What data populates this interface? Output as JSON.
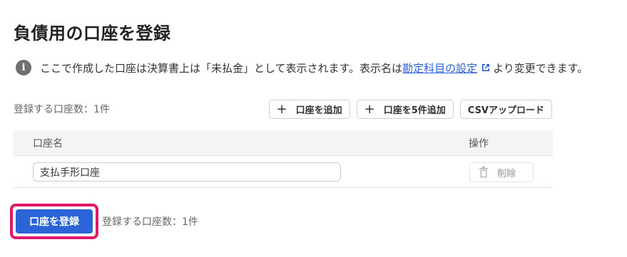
{
  "page": {
    "title": "負債用の口座を登録"
  },
  "info": {
    "icon": "info-icon",
    "text_before": "ここで作成した口座は決算書上は「未払金」として表示されます。表示名は",
    "link_label": "勘定科目の設定",
    "text_after": "より変更できます。"
  },
  "register_count_top": "登録する口座数：1件",
  "toolbar": {
    "add_label": "口座を追加",
    "add_five_label": "口座を5件追加",
    "csv_label": "CSVアップロード"
  },
  "table": {
    "columns": [
      "口座名",
      "操作"
    ],
    "rows": [
      {
        "account_name": "支払手形口座",
        "delete_label": "削除"
      }
    ]
  },
  "footer": {
    "submit_label": "口座を登録",
    "register_count": "登録する口座数：1件"
  },
  "colors": {
    "primary": "#2a64d6",
    "highlight": "#e0186a",
    "link": "#2b62d6"
  }
}
